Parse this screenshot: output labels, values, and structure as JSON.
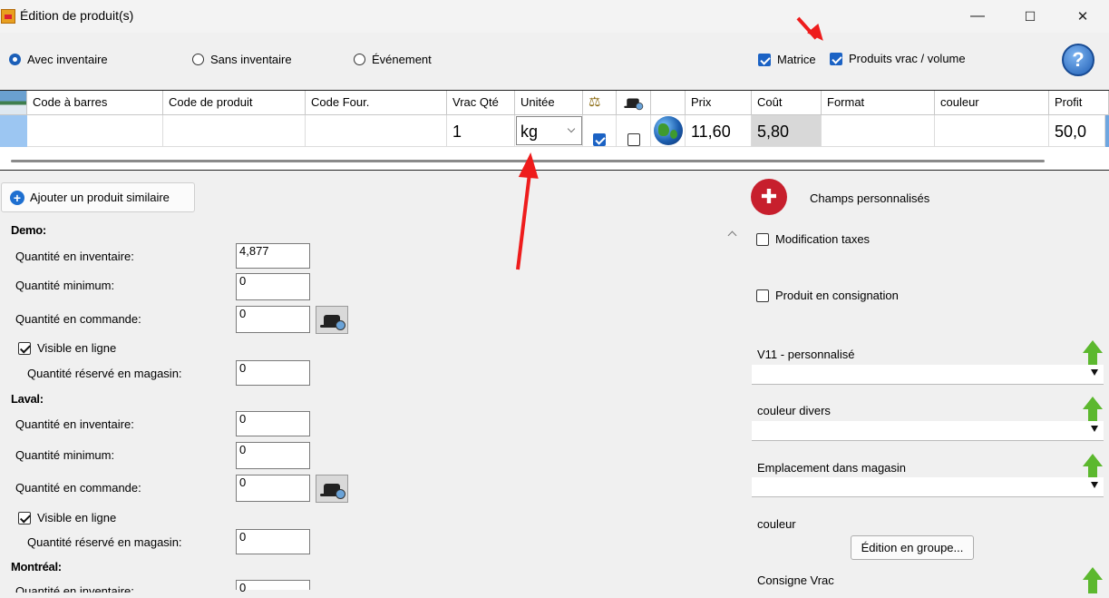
{
  "window": {
    "title": "Édition de produit(s)",
    "minimize": "—",
    "maximize": "☐",
    "close": "✕"
  },
  "mode": {
    "options": [
      {
        "label": "Avec inventaire",
        "selected": true
      },
      {
        "label": "Sans inventaire",
        "selected": false
      },
      {
        "label": "Événement",
        "selected": false
      }
    ],
    "matrice_label": "Matrice",
    "matrice_checked": true,
    "vrac_label": "Produits vrac / volume",
    "vrac_checked": true,
    "help": "?"
  },
  "grid": {
    "columns": [
      "Code à barres",
      "Code de produit",
      "Code Four.",
      "Vrac Qté",
      "Unitée",
      "",
      "",
      "",
      "Prix",
      "Coût",
      "Format",
      "couleur",
      "Profit"
    ],
    "row": {
      "code_barres": "",
      "code_produit": "",
      "code_four": "",
      "vrac_qte": "1",
      "unitee": "kg",
      "balance_checked": true,
      "hat_checked": false,
      "prix": "11,60",
      "cout": "5,80",
      "format": "",
      "couleur": "",
      "profit": "50,0"
    }
  },
  "left": {
    "add_similar": "Ajouter un produit similaire",
    "stores": [
      {
        "name": "Demo:",
        "qte_inventaire": "4,877",
        "qte_minimum": "0",
        "qte_commande": "0",
        "visible": "Visible en ligne",
        "qte_reserve": "0"
      },
      {
        "name": "Laval:",
        "qte_inventaire": "0",
        "qte_minimum": "0",
        "qte_commande": "0",
        "visible": "Visible en ligne",
        "qte_reserve": "0"
      },
      {
        "name": "Montréal:",
        "qte_inventaire": "0"
      }
    ],
    "labels": {
      "qte_inventaire": "Quantité en inventaire:",
      "qte_minimum": "Quantité minimum:",
      "qte_commande": "Quantité en commande:",
      "qte_reserve": "Quantité réservé en magasin:"
    }
  },
  "right": {
    "custom_fields": "Champs personnalisés",
    "mod_taxes": "Modification taxes",
    "consignation": "Produit en consignation",
    "fields": [
      "V11 - personnalisé",
      "couleur divers",
      "Emplacement dans magasin"
    ],
    "couleur_label": "couleur",
    "group_edit": "Édition en groupe...",
    "consigne_vrac": "Consigne Vrac"
  }
}
